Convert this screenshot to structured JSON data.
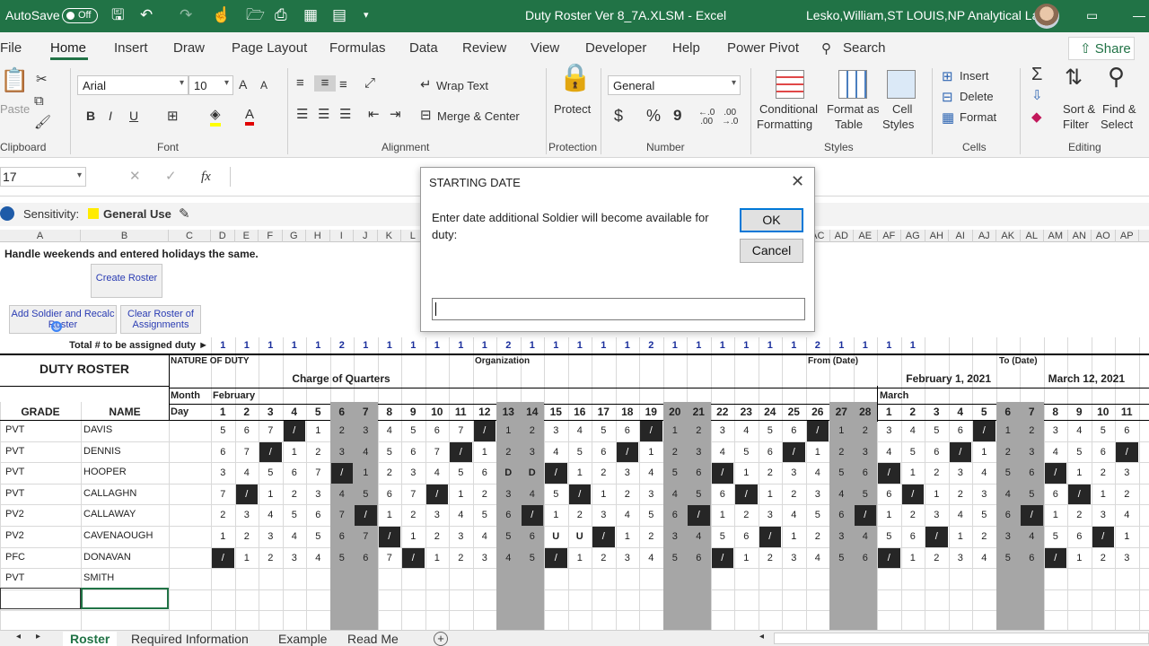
{
  "titlebar": {
    "autosave_label": "AutoSave",
    "autosave_state": "Off",
    "file_title": "Duty Roster Ver 8_7A.XLSM  -  Excel",
    "user": "Lesko,William,ST LOUIS,NP Analytical Labs",
    "brand_color": "#217346"
  },
  "ribbon_tabs": [
    "File",
    "Home",
    "Insert",
    "Draw",
    "Page Layout",
    "Formulas",
    "Data",
    "Review",
    "View",
    "Developer",
    "Help",
    "Power Pivot"
  ],
  "search_label": "Search",
  "share_label": "Share",
  "ribbon": {
    "clipboard": {
      "paste": "Paste",
      "label": "Clipboard"
    },
    "font": {
      "name": "Arial",
      "size": "10",
      "label": "Font",
      "bold": "B",
      "italic": "I",
      "underline": "U",
      "grow": "A",
      "shrink": "A",
      "font_color_mark": "A"
    },
    "alignment": {
      "wrap": "Wrap Text",
      "merge": "Merge & Center",
      "label": "Alignment"
    },
    "protection": {
      "protect": "Protect",
      "label": "Protection"
    },
    "number": {
      "format": "General",
      "currency": "$",
      "percent": "%",
      "comma": "9",
      "inc_decimal": "←.0\n.00",
      "dec_decimal": ".00\n→.0",
      "label": "Number"
    },
    "styles": {
      "cond_line1": "Conditional",
      "cond_line2": "Formatting",
      "fmt_table_line1": "Format as",
      "fmt_table_line2": "Table",
      "cell_styles_line1": "Cell",
      "cell_styles_line2": "Styles",
      "label": "Styles"
    },
    "cells": {
      "insert": "Insert",
      "delete": "Delete",
      "format": "Format",
      "label": "Cells"
    },
    "editing": {
      "sort_line1": "Sort &",
      "sort_line2": "Filter",
      "find_line1": "Find &",
      "find_line2": "Select",
      "label": "Editing"
    }
  },
  "formula_bar": {
    "name_box": "17",
    "fx": "fx"
  },
  "sensitivity": {
    "label": "Sensitivity:",
    "value": "General Use"
  },
  "columns": [
    "A",
    "B",
    "C",
    "D",
    "E",
    "F",
    "G",
    "H",
    "I",
    "J",
    "K",
    "L",
    "AC",
    "AD",
    "AE",
    "AF",
    "AG",
    "AH",
    "AI",
    "AJ",
    "AK",
    "AL",
    "AM",
    "AN",
    "AO",
    "AP"
  ],
  "sheet": {
    "note": "Handle weekends and entered holidays the same.",
    "create_roster": "Create Roster",
    "add_soldier": "Add Soldier and Recalc Roster",
    "clear_roster": "Clear Roster of Assignments",
    "total_label": "Total # to be assigned duty ►",
    "totals": [
      "1",
      "1",
      "1",
      "1",
      "1",
      "2",
      "1",
      "1",
      "1",
      "1",
      "1",
      "1",
      "2",
      "1",
      "1",
      "1",
      "1",
      "1",
      "2",
      "1",
      "1",
      "1",
      "1",
      "1",
      "1",
      "2",
      "1",
      "1",
      "1",
      "1"
    ],
    "duty_roster": "DUTY ROSTER",
    "nature_label": "NATURE OF DUTY",
    "nature_value": "Charge of Quarters",
    "org_label": "Organization",
    "from_label": "From (Date)",
    "from_value": "February 1, 2021",
    "to_label": "To (Date)",
    "to_value": "March 12, 2021",
    "month_label": "Month",
    "day_label": "Day",
    "month1": "February",
    "month2": "March",
    "grade_hdr": "GRADE",
    "name_hdr": "NAME",
    "days": [
      "1",
      "2",
      "3",
      "4",
      "5",
      "6",
      "7",
      "8",
      "9",
      "10",
      "11",
      "12",
      "13",
      "14",
      "15",
      "16",
      "17",
      "18",
      "19",
      "20",
      "21",
      "22",
      "23",
      "24",
      "25",
      "26",
      "27",
      "28",
      "1",
      "2",
      "3",
      "4",
      "5",
      "6",
      "7",
      "8",
      "9",
      "10",
      "11"
    ],
    "rows": [
      {
        "grade": "PVT",
        "name": "DAVIS",
        "cells": [
          "5",
          "6",
          "7",
          "/",
          "1",
          "2",
          "3",
          "4",
          "5",
          "6",
          "7",
          "/",
          "1",
          "2",
          "3",
          "4",
          "5",
          "6",
          "/",
          "1",
          "2",
          "3",
          "4",
          "5",
          "6",
          "/",
          "1",
          "2",
          "3",
          "4",
          "5",
          "6",
          "/",
          "1",
          "2",
          "3",
          "4",
          "5",
          "6"
        ]
      },
      {
        "grade": "PVT",
        "name": "DENNIS",
        "cells": [
          "6",
          "7",
          "/",
          "1",
          "2",
          "3",
          "4",
          "5",
          "6",
          "7",
          "/",
          "1",
          "2",
          "3",
          "4",
          "5",
          "6",
          "/",
          "1",
          "2",
          "3",
          "4",
          "5",
          "6",
          "/",
          "1",
          "2",
          "3",
          "4",
          "5",
          "6",
          "/",
          "1",
          "2",
          "3",
          "4",
          "5",
          "6",
          "/"
        ]
      },
      {
        "grade": "PVT",
        "name": "HOOPER",
        "cells": [
          "3",
          "4",
          "5",
          "6",
          "7",
          "/",
          "1",
          "2",
          "3",
          "4",
          "5",
          "6",
          "D",
          "D",
          "/",
          "1",
          "2",
          "3",
          "4",
          "5",
          "6",
          "/",
          "1",
          "2",
          "3",
          "4",
          "5",
          "6",
          "/",
          "1",
          "2",
          "3",
          "4",
          "5",
          "6",
          "/",
          "1",
          "2",
          "3"
        ]
      },
      {
        "grade": "PVT",
        "name": "CALLAGHN",
        "cells": [
          "7",
          "/",
          "1",
          "2",
          "3",
          "4",
          "5",
          "6",
          "7",
          "/",
          "1",
          "2",
          "3",
          "4",
          "5",
          "/",
          "1",
          "2",
          "3",
          "4",
          "5",
          "6",
          "/",
          "1",
          "2",
          "3",
          "4",
          "5",
          "6",
          "/",
          "1",
          "2",
          "3",
          "4",
          "5",
          "6",
          "/",
          "1",
          "2"
        ]
      },
      {
        "grade": "PV2",
        "name": "CALLAWAY",
        "cells": [
          "2",
          "3",
          "4",
          "5",
          "6",
          "7",
          "/",
          "1",
          "2",
          "3",
          "4",
          "5",
          "6",
          "/",
          "1",
          "2",
          "3",
          "4",
          "5",
          "6",
          "/",
          "1",
          "2",
          "3",
          "4",
          "5",
          "6",
          "/",
          "1",
          "2",
          "3",
          "4",
          "5",
          "6",
          "/",
          "1",
          "2",
          "3",
          "4"
        ]
      },
      {
        "grade": "PV2",
        "name": "CAVENAOUGH",
        "cells": [
          "1",
          "2",
          "3",
          "4",
          "5",
          "6",
          "7",
          "/",
          "1",
          "2",
          "3",
          "4",
          "5",
          "6",
          "U",
          "U",
          "/",
          "1",
          "2",
          "3",
          "4",
          "5",
          "6",
          "/",
          "1",
          "2",
          "3",
          "4",
          "5",
          "6",
          "/",
          "1",
          "2",
          "3",
          "4",
          "5",
          "6",
          "/",
          "1"
        ]
      },
      {
        "grade": "PFC",
        "name": "DONAVAN",
        "cells": [
          "/",
          "1",
          "2",
          "3",
          "4",
          "5",
          "6",
          "7",
          "/",
          "1",
          "2",
          "3",
          "4",
          "5",
          "/",
          "1",
          "2",
          "3",
          "4",
          "5",
          "6",
          "/",
          "1",
          "2",
          "3",
          "4",
          "5",
          "6",
          "/",
          "1",
          "2",
          "3",
          "4",
          "5",
          "6",
          "/",
          "1",
          "2",
          "3"
        ]
      },
      {
        "grade": "PVT",
        "name": "SMITH",
        "cells": []
      }
    ]
  },
  "sheet_tabs": [
    "Roster",
    "Required Information",
    "Example",
    "Read Me"
  ],
  "dialog": {
    "title": "STARTING DATE",
    "message": "Enter date additional Soldier will become available for duty:",
    "ok": "OK",
    "cancel": "Cancel",
    "input_value": ""
  }
}
